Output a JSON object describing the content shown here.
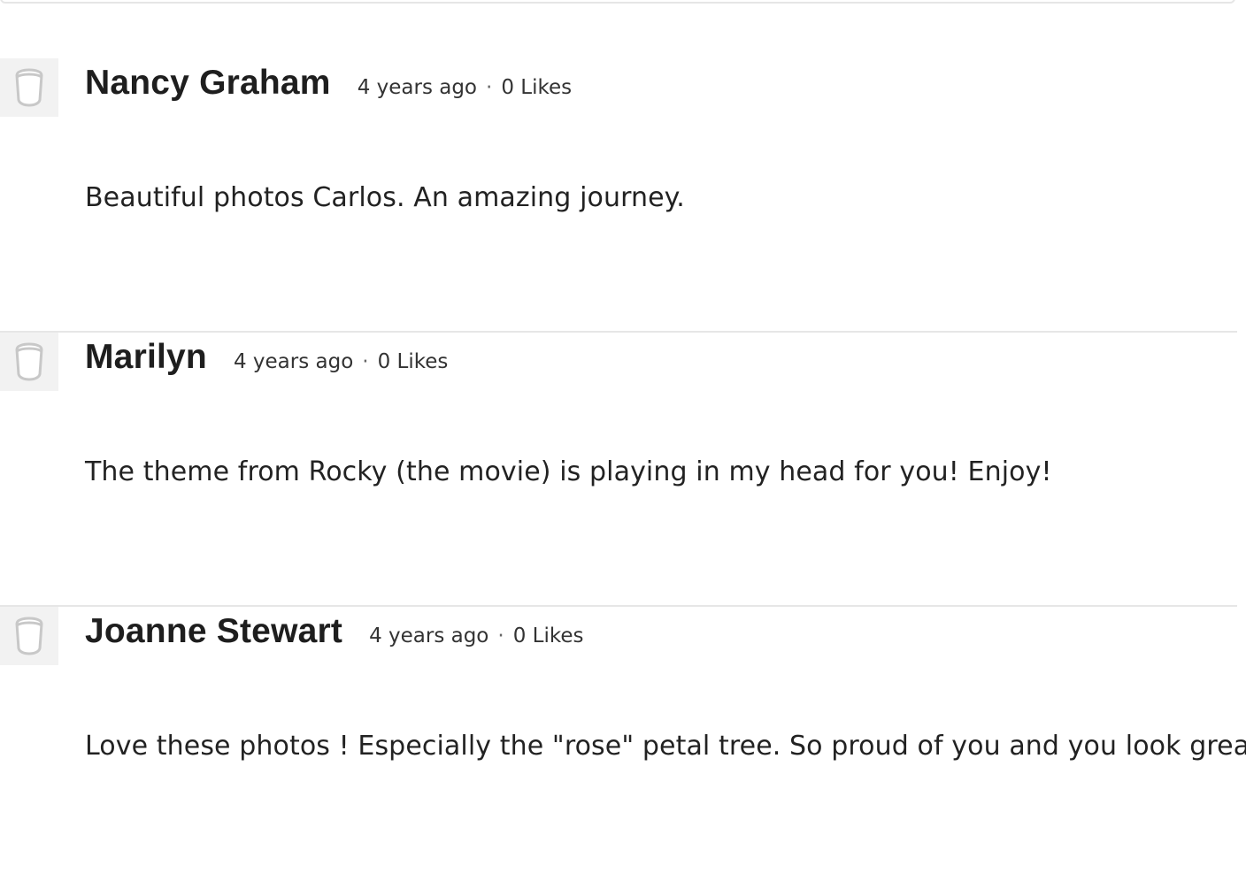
{
  "comments": [
    {
      "author": "Nancy Graham",
      "time": "4 years ago",
      "separator": "·",
      "likes": "0 Likes",
      "text": "Beautiful photos Carlos. An amazing journey."
    },
    {
      "author": "Marilyn",
      "time": "4 years ago",
      "separator": "·",
      "likes": "0 Likes",
      "text": "The theme from Rocky (the movie) is playing in my head for you! Enjoy!"
    },
    {
      "author": "Joanne Stewart",
      "time": "4 years ago",
      "separator": "·",
      "likes": "0 Likes",
      "text": "Love these photos ! Especially the \"rose\" petal tree. So proud of you and you look great."
    }
  ],
  "icons": {
    "avatar": "default-avatar-icon"
  },
  "colors": {
    "divider": "#e6e6e6",
    "avatar_bg": "#f2f2f2",
    "text": "#222222"
  }
}
